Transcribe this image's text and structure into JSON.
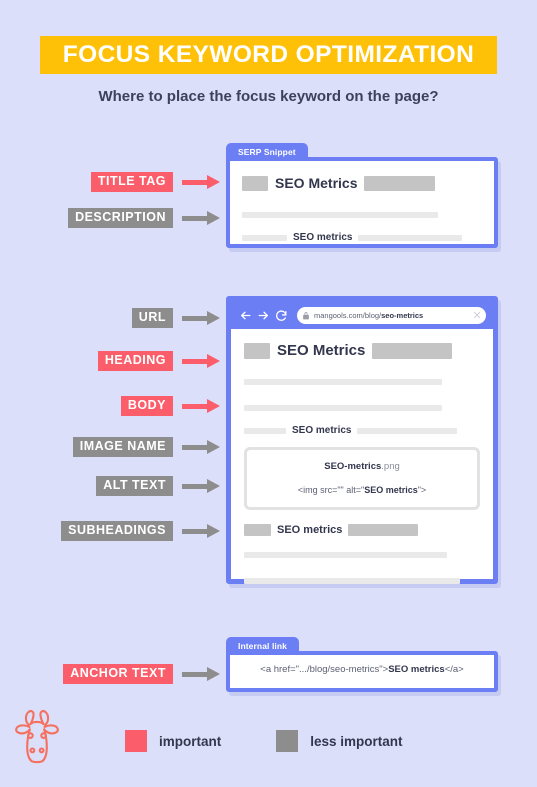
{
  "header": {
    "title": "FOCUS KEYWORD OPTIMIZATION",
    "subtitle": "Where to place the focus keyword on the page?",
    "band_color": "#ffc107",
    "title_color": "#ffffff",
    "subtitle_color": "#3d4159"
  },
  "theme": {
    "background": "#dcdffa",
    "important_color": "#fb5d6a",
    "less_important_color": "#8d8d8d",
    "frame_blue": "#6b7ef3",
    "keyword_text_color": "#33374d"
  },
  "labels": {
    "title_tag": "TITLE TAG",
    "description": "DESCRIPTION",
    "url": "URL",
    "heading": "HEADING",
    "body": "BODY",
    "image_name": "IMAGE NAME",
    "alt_text": "ALT TEXT",
    "subheadings": "SUBHEADINGS",
    "anchor_text": "ANCHOR TEXT"
  },
  "serp_card": {
    "tab_label": "SERP Snippet",
    "title_keyword": "SEO Metrics",
    "description_keyword": "SEO metrics"
  },
  "browser": {
    "url_prefix": "mangools.com/blog/",
    "url_keyword": "seo-metrics",
    "icons": {
      "back": "back-arrow-icon",
      "forward": "forward-arrow-icon",
      "reload": "reload-icon",
      "lock": "lock-icon",
      "close": "close-icon"
    },
    "page": {
      "heading_keyword": "SEO Metrics",
      "body_keyword": "SEO metrics",
      "image_filename_bold": "SEO-metrics",
      "image_filename_ext": ".png",
      "img_tag_prefix": "<img src=\"\" alt=\"",
      "img_tag_keyword": "SEO metrics",
      "img_tag_suffix": "\">",
      "subheading_keyword": "SEO metrics"
    }
  },
  "anchor_card": {
    "tab_label": "Internal link",
    "code_prefix": "<a href=\".../blog/seo-metrics\">",
    "code_keyword": "SEO metrics",
    "code_suffix": "</a>"
  },
  "legend": {
    "important": "important",
    "less_important": "less important"
  },
  "mascot": {
    "name": "giraffe-mascot",
    "color": "#f4705f"
  }
}
